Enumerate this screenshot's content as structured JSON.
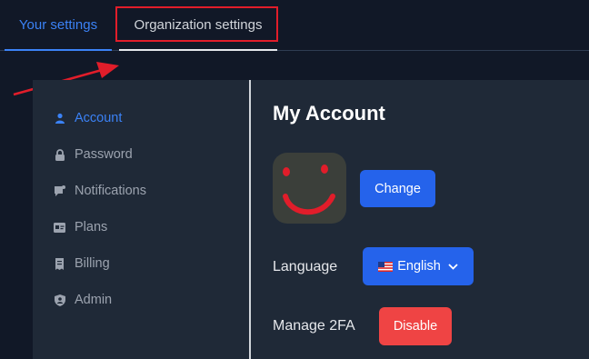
{
  "tabs": [
    {
      "label": "Your settings",
      "active": true
    },
    {
      "label": "Organization settings",
      "active": false
    }
  ],
  "sidebar": {
    "items": [
      {
        "label": "Account",
        "icon": "user-icon",
        "active": true
      },
      {
        "label": "Password",
        "icon": "lock-icon"
      },
      {
        "label": "Notifications",
        "icon": "bell-icon"
      },
      {
        "label": "Plans",
        "icon": "card-icon"
      },
      {
        "label": "Billing",
        "icon": "receipt-icon"
      },
      {
        "label": "Admin",
        "icon": "shield-icon"
      }
    ]
  },
  "main": {
    "title": "My Account",
    "change_button": "Change",
    "language_label": "Language",
    "language_value": "English",
    "language_flag": "flag-us-icon",
    "twofa_label": "Manage 2FA",
    "disable_button": "Disable"
  },
  "colors": {
    "accent": "#2563eb",
    "danger": "#ef4444",
    "annotation": "#e11d2a"
  }
}
